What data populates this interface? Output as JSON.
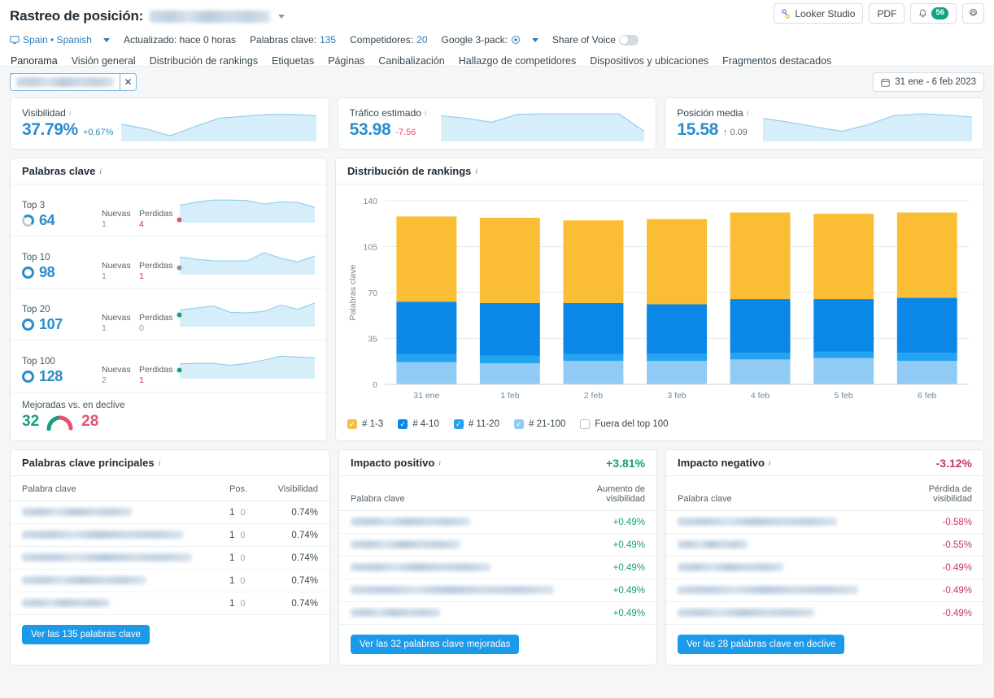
{
  "header": {
    "title": "Rastreo de posición:",
    "project_redacted": true,
    "looker_label": "Looker Studio",
    "pdf_label": "PDF",
    "notification_count": "56",
    "meta": {
      "location": "Spain • Spanish",
      "updated": "Actualizado: hace 0 horas",
      "keywords_label": "Palabras clave:",
      "keywords_value": "135",
      "competitors_label": "Competidores:",
      "competitors_value": "20",
      "google3pack_label": "Google 3-pack:",
      "share_of_voice_label": "Share of Voice"
    },
    "tabs": [
      {
        "label": "Panorama",
        "active": true
      },
      {
        "label": "Visión general",
        "active": false
      },
      {
        "label": "Distribución de rankings",
        "active": false
      },
      {
        "label": "Etiquetas",
        "active": false
      },
      {
        "label": "Páginas",
        "active": false
      },
      {
        "label": "Canibalización",
        "active": false
      },
      {
        "label": "Hallazgo de competidores",
        "active": false
      },
      {
        "label": "Dispositivos y ubicaciones",
        "active": false
      },
      {
        "label": "Fragmentos destacados",
        "active": false
      }
    ]
  },
  "filterbar": {
    "date_range": "31 ene - 6 feb 2023"
  },
  "kpis": [
    {
      "label": "Visibilidad",
      "value": "37.79%",
      "delta": "+0.67%",
      "delta_kind": "pos",
      "spark": [
        52,
        66,
        88,
        60,
        34,
        28,
        22,
        22,
        26
      ]
    },
    {
      "label": "Tráfico estimado",
      "value": "53.98",
      "delta": "-7.56",
      "delta_kind": "neg",
      "spark": [
        26,
        34,
        46,
        22,
        20,
        20,
        20,
        20,
        74
      ]
    },
    {
      "label": "Posición media",
      "value": "15.58",
      "delta": "↑ 0.09",
      "delta_kind": "up",
      "spark": [
        34,
        46,
        60,
        74,
        54,
        26,
        20,
        24,
        30
      ]
    }
  ],
  "keywords_panel": {
    "title": "Palabras clave",
    "new_label": "Nuevas",
    "lost_label": "Perdidas",
    "items": [
      {
        "tier": "Top 3",
        "count": "64",
        "new": "1",
        "lost": "4",
        "dot": "#e4526c",
        "ring": "grey",
        "spark": [
          36,
          22,
          14,
          14,
          16,
          30,
          22,
          24,
          44
        ]
      },
      {
        "tier": "Top 10",
        "count": "98",
        "new": "1",
        "lost": "1",
        "dot": "#8a949c",
        "ring": "full",
        "spark": [
          34,
          44,
          50,
          50,
          50,
          16,
          40,
          54,
          30
        ]
      },
      {
        "tier": "Top 20",
        "count": "107",
        "new": "1",
        "lost": "0",
        "dot": "#179e7f",
        "ring": "full",
        "spark": [
          38,
          30,
          22,
          48,
          50,
          44,
          18,
          36,
          10
        ]
      },
      {
        "tier": "Top 100",
        "count": "128",
        "new": "2",
        "lost": "1",
        "dot": "#179e7f",
        "ring": "full",
        "spark": [
          46,
          44,
          44,
          52,
          44,
          30,
          14,
          18,
          22
        ]
      }
    ],
    "improved_declined_label": "Mejoradas vs. en declive",
    "improved": "32",
    "declined": "28"
  },
  "chart_data": {
    "type": "bar",
    "title": "Distribución de rankings",
    "stacked": true,
    "xlabel": "",
    "ylabel": "Palabras clave",
    "ylim": [
      0,
      140
    ],
    "yticks": [
      0,
      35,
      70,
      105,
      140
    ],
    "grid": true,
    "legend_position": "bottom",
    "categories": [
      "31 ene",
      "1 feb",
      "2 feb",
      "3 feb",
      "4 feb",
      "5 feb",
      "6 feb"
    ],
    "series": [
      {
        "name": "# 1-3",
        "color": "#92caf6",
        "values": [
          17,
          16,
          18,
          18,
          19,
          20,
          18
        ]
      },
      {
        "name": "# 4-10",
        "color": "#23a3f0",
        "values": [
          6,
          6,
          5,
          5,
          5,
          5,
          6
        ]
      },
      {
        "name": "# 11-20",
        "color": "#0b87e8",
        "values": [
          40,
          40,
          39,
          38,
          41,
          40,
          42
        ]
      },
      {
        "name": "# 21-100",
        "color": "#fabd33",
        "values": [
          65,
          65,
          63,
          65,
          66,
          65,
          65
        ]
      },
      {
        "name": "Fuera del top 100",
        "color": "#ffffff",
        "values": [
          0,
          0,
          0,
          0,
          0,
          0,
          0
        ]
      }
    ],
    "legend": [
      {
        "label": "# 1-3",
        "color": "#f5c043",
        "checked": true
      },
      {
        "label": "# 4-10",
        "color": "#0b87e8",
        "checked": true
      },
      {
        "label": "# 11-20",
        "color": "#23a3f0",
        "checked": true
      },
      {
        "label": "# 21-100",
        "color": "#92caf6",
        "checked": true
      },
      {
        "label": "Fuera del top 100",
        "color": "#ffffff",
        "checked": false
      }
    ]
  },
  "top_keywords": {
    "title": "Palabras clave principales",
    "columns": [
      "Palabra clave",
      "Pos.",
      "Visibilidad"
    ],
    "rows": [
      {
        "kw_width": 135,
        "pos": "1",
        "delta": "0",
        "vis": "0.74%"
      },
      {
        "kw_width": 198,
        "pos": "1",
        "delta": "0",
        "vis": "0.74%"
      },
      {
        "kw_width": 209,
        "pos": "1",
        "delta": "0",
        "vis": "0.74%"
      },
      {
        "kw_width": 152,
        "pos": "1",
        "delta": "0",
        "vis": "0.74%"
      },
      {
        "kw_width": 108,
        "pos": "1",
        "delta": "0",
        "vis": "0.74%"
      }
    ],
    "button": "Ver las 135 palabras clave"
  },
  "positive_impact": {
    "title": "Impacto positivo",
    "summary": "+3.81%",
    "columns": [
      "Palabra clave",
      "Aumento de visibilidad"
    ],
    "rows": [
      {
        "kw_width": 147,
        "value": "+0.49%"
      },
      {
        "kw_width": 135,
        "value": "+0.49%"
      },
      {
        "kw_width": 172,
        "value": "+0.49%"
      },
      {
        "kw_width": 250,
        "value": "+0.49%"
      },
      {
        "kw_width": 110,
        "value": "+0.49%"
      }
    ],
    "button": "Ver las 32 palabras clave mejoradas"
  },
  "negative_impact": {
    "title": "Impacto negativo",
    "summary": "-3.12%",
    "columns": [
      "Palabra clave",
      "Pérdida de visibilidad"
    ],
    "rows": [
      {
        "kw_width": 196,
        "value": "-0.58%"
      },
      {
        "kw_width": 86,
        "value": "-0.55%"
      },
      {
        "kw_width": 130,
        "value": "-0.49%"
      },
      {
        "kw_width": 222,
        "value": "-0.49%"
      },
      {
        "kw_width": 168,
        "value": "-0.49%"
      }
    ],
    "button": "Ver las 28 palabras clave en declive"
  }
}
